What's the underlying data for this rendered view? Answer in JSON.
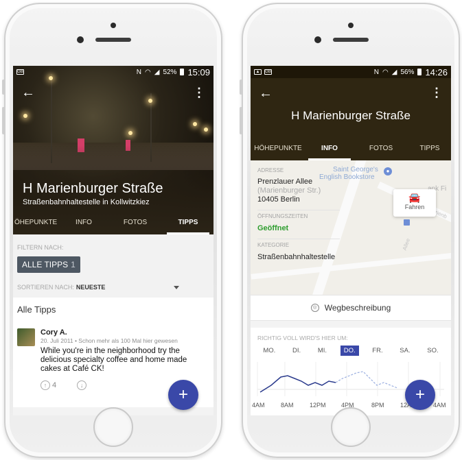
{
  "left_phone": {
    "status": {
      "time": "15:09",
      "battery": "52%"
    },
    "header": {
      "title": "H Marienburger Straße",
      "subtitle": "Straßenbahnhaltestelle in Kollwitzkiez"
    },
    "tabs": [
      {
        "label": "ÖHEPUNKTE",
        "active": false
      },
      {
        "label": "INFO",
        "active": false
      },
      {
        "label": "FOTOS",
        "active": false
      },
      {
        "label": "TIPPS",
        "active": true
      }
    ],
    "filter": {
      "label": "FILTERN NACH:",
      "chip_label": "ALLE TIPPS",
      "chip_count": "1"
    },
    "sort": {
      "label": "SORTIEREN NACH:",
      "value": "NEUESTE"
    },
    "section_title": "Alle Tipps",
    "tip": {
      "author": "Cory A.",
      "date": "20. Juli 2011",
      "meta": "Schon mehr als 100 Mal hier gewesen",
      "text": "While you're in the neighborhood try the delicious specialty coffee and home made cakes at Café CK!",
      "upvotes": "4"
    },
    "fab": "+"
  },
  "right_phone": {
    "status": {
      "time": "14:26",
      "battery": "56%"
    },
    "header": {
      "title": "H Marienburger Straße"
    },
    "tabs": [
      {
        "label": "HÖHEPUNKTE",
        "active": false
      },
      {
        "label": "INFO",
        "active": true
      },
      {
        "label": "FOTOS",
        "active": false
      },
      {
        "label": "TIPPS",
        "active": false
      }
    ],
    "address": {
      "label": "ADRESSE",
      "line1": "Prenzlauer Allee",
      "line2": "(Marienburger Str.)",
      "line3": "10405 Berlin"
    },
    "hours": {
      "label": "ÖFFNUNGSZEITEN",
      "value": "Geöffnet"
    },
    "category": {
      "label": "KATEGORIE",
      "value": "Straßenbahnhaltestelle"
    },
    "map_labels": [
      "Saint George's",
      "English Bookstore",
      "ank Fi",
      "Marienb",
      "Allee"
    ],
    "drive_button": "Fahren",
    "directions": "Wegbeschreibung",
    "busy": {
      "label": "RICHTIG VOLL WIRD'S HIER UM:",
      "days": [
        {
          "label": "MO.",
          "active": false
        },
        {
          "label": "DI.",
          "active": false
        },
        {
          "label": "MI.",
          "active": false
        },
        {
          "label": "DO.",
          "active": true
        },
        {
          "label": "FR.",
          "active": false
        },
        {
          "label": "SA.",
          "active": false
        },
        {
          "label": "SO.",
          "active": false
        }
      ],
      "hour_labels": [
        "4AM",
        "8AM",
        "12PM",
        "4PM",
        "8PM",
        "12AM",
        "4AM"
      ]
    },
    "fab": "+"
  }
}
